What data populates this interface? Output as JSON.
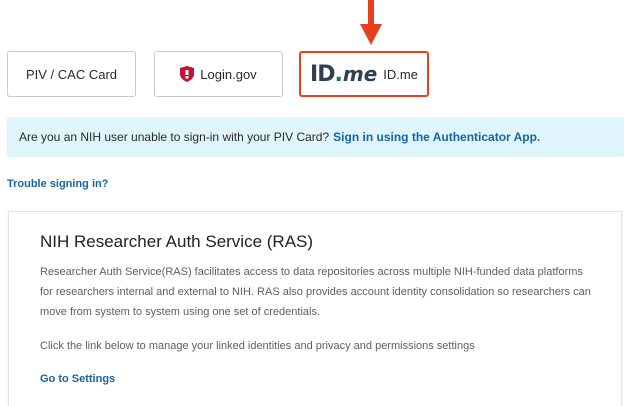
{
  "login_options": {
    "piv_label": "PIV / CAC Card",
    "logingov_label": "Login.gov",
    "idme_logo": {
      "id": "ID",
      "dot": ".",
      "me": "me"
    },
    "idme_label": "ID.me"
  },
  "colors": {
    "accent_red": "#e8401c",
    "link_blue": "#1565a8",
    "banner_bg": "#dff4fb",
    "logingov_red": "#c4122f",
    "idme_green": "#08833d"
  },
  "banner": {
    "text": "Are you an NIH user unable to sign-in with your PIV Card?",
    "link": "Sign in using the Authenticator App."
  },
  "trouble_link": "Trouble signing in?",
  "ras": {
    "title": "NIH Researcher Auth Service (RAS)",
    "description": "Researcher Auth Service(RAS) facilitates access to data repositories across multiple NIH-funded data platforms for researchers internal and external to NIH. RAS also provides account identity consolidation so researchers can move from system to system using one set of credentials.",
    "manage_text": "Click the link below to manage your linked identities and privacy and permissions settings",
    "settings_link": "Go to Settings"
  },
  "icons": {
    "pointer": "arrow-down-icon",
    "logingov": "shield-icon"
  }
}
